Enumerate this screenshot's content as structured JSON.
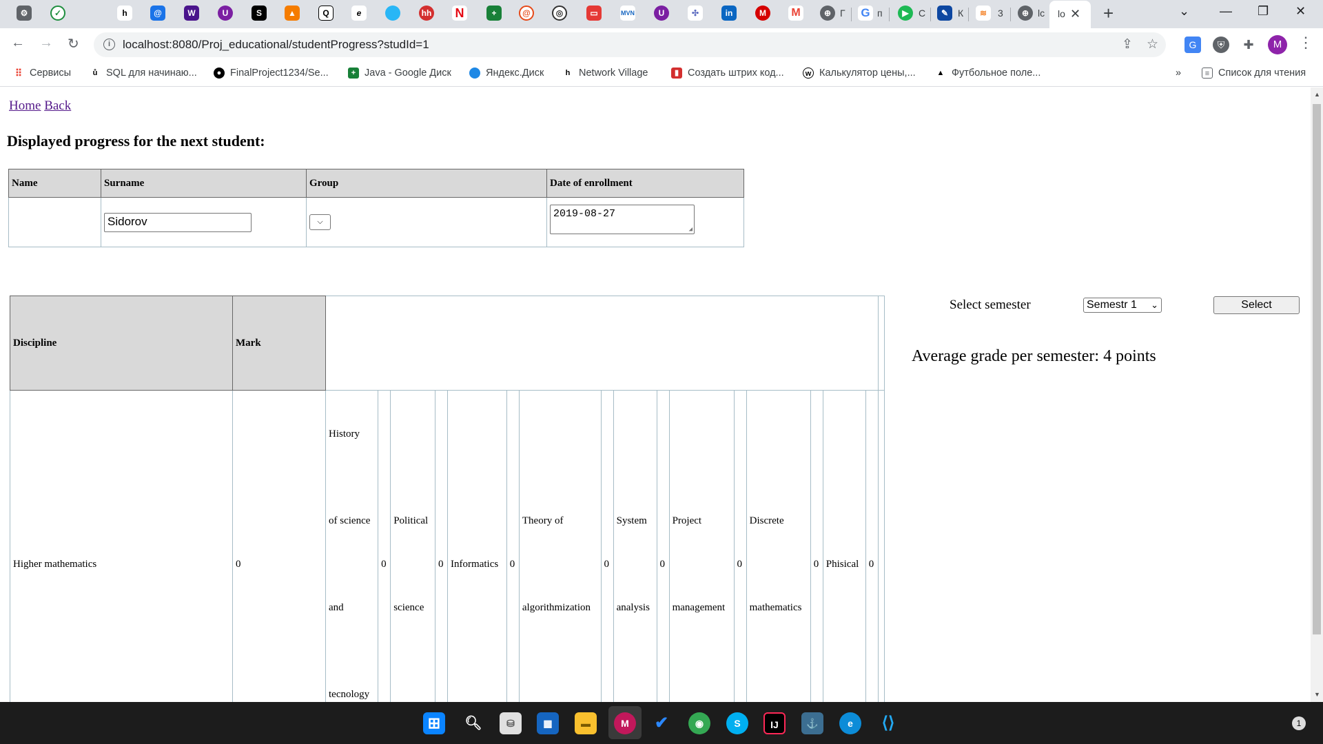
{
  "browser": {
    "tabs_partial": [
      "Г",
      "п",
      "С",
      "К",
      "3",
      "lc",
      "lo"
    ],
    "url": "localhost:8080/Proj_educational/studentProgress?studId=1",
    "profile_initial": "M",
    "bookmarks": [
      "Сервисы",
      "SQL для начинаю...",
      "FinalProject1234/Se...",
      "Java - Google Диск",
      "Яндекс.Диск",
      "Network Village",
      "Создать штрих код...",
      "Калькулятор цены,...",
      "Футбольное поле..."
    ],
    "bookmarks_overflow": "»",
    "reading_list": "Список для чтения"
  },
  "page": {
    "nav": {
      "home": "Home",
      "back": "Back"
    },
    "heading": "Displayed progress for the next student:",
    "student_table": {
      "headers": [
        "Name",
        "Surname",
        "Group",
        "Date of enrollment"
      ],
      "name_value": "",
      "surname_value": "Sidorov",
      "date_value": "2019-08-27"
    },
    "discipline_table": {
      "headers": [
        "Discipline",
        "Mark"
      ],
      "first_row": {
        "discipline": "Higher mathematics",
        "mark": "0"
      },
      "extra_cells": [
        {
          "lines": [
            "History",
            "of science",
            "and",
            "tecnology"
          ]
        },
        {
          "value": "0"
        },
        {
          "lines": [
            "Political",
            "science"
          ]
        },
        {
          "value": "0"
        },
        {
          "lines": [
            "Informatics"
          ]
        },
        {
          "value": "0"
        },
        {
          "lines": [
            "Theory of",
            "algorithmization"
          ]
        },
        {
          "value": "0"
        },
        {
          "lines": [
            "System",
            "analysis"
          ]
        },
        {
          "value": "0"
        },
        {
          "lines": [
            "Project",
            "management"
          ]
        },
        {
          "value": "0"
        },
        {
          "lines": [
            "Discrete",
            "mathematics"
          ]
        },
        {
          "value": "0"
        },
        {
          "lines": [
            "Phisical"
          ]
        },
        {
          "value": "0"
        }
      ]
    },
    "semester": {
      "label": "Select semester",
      "selected": "Semestr 1",
      "button": "Select"
    },
    "average": "Average grade per semester: 4 points"
  },
  "taskbar": {
    "notification_count": "1"
  }
}
